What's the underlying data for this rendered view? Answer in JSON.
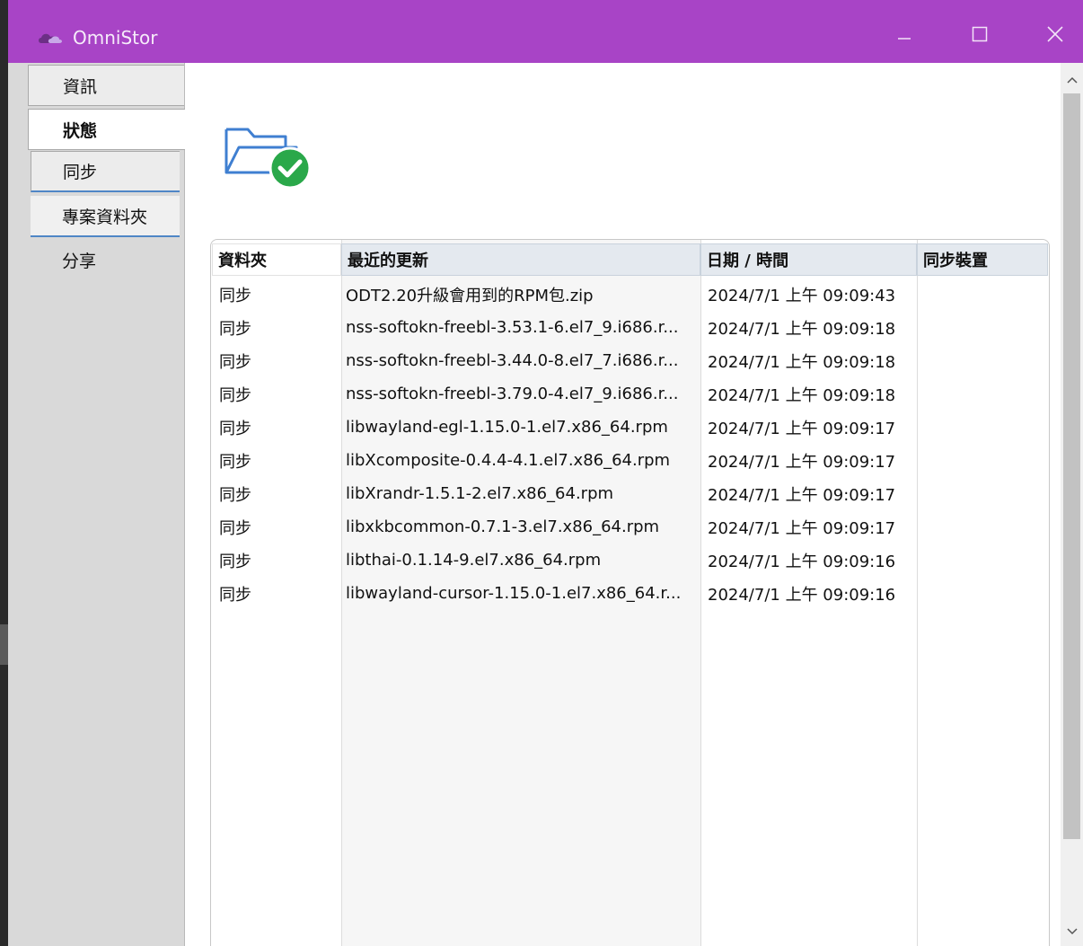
{
  "app": {
    "title": "OmniStor"
  },
  "colors": {
    "titlebar": "#a844c6",
    "accent": "#4f86c6",
    "success": "#2aa84a"
  },
  "icons": [
    "cloud-logo-icon",
    "minimize-icon",
    "maximize-icon",
    "close-icon",
    "folder-check-icon",
    "scroll-up-icon",
    "scroll-down-icon"
  ],
  "sidebar": {
    "items": [
      {
        "label": "資訊"
      },
      {
        "label": "狀態"
      },
      {
        "label": "同步"
      },
      {
        "label": "專案資料夾"
      },
      {
        "label": "分享"
      }
    ]
  },
  "table": {
    "headers": [
      "資料夾",
      "最近的更新",
      "日期 / 時間",
      "同步裝置"
    ],
    "rows": [
      [
        "同步",
        "ODT2.20升級會用到的RPM包.zip",
        "2024/7/1 上午 09:09:43",
        ""
      ],
      [
        "同步",
        "nss-softokn-freebl-3.53.1-6.el7_9.i686.r...",
        "2024/7/1 上午 09:09:18",
        ""
      ],
      [
        "同步",
        "nss-softokn-freebl-3.44.0-8.el7_7.i686.r...",
        "2024/7/1 上午 09:09:18",
        ""
      ],
      [
        "同步",
        "nss-softokn-freebl-3.79.0-4.el7_9.i686.r...",
        "2024/7/1 上午 09:09:18",
        ""
      ],
      [
        "同步",
        "libwayland-egl-1.15.0-1.el7.x86_64.rpm",
        "2024/7/1 上午 09:09:17",
        ""
      ],
      [
        "同步",
        "libXcomposite-0.4.4-4.1.el7.x86_64.rpm",
        "2024/7/1 上午 09:09:17",
        ""
      ],
      [
        "同步",
        "libXrandr-1.5.1-2.el7.x86_64.rpm",
        "2024/7/1 上午 09:09:17",
        ""
      ],
      [
        "同步",
        "libxkbcommon-0.7.1-3.el7.x86_64.rpm",
        "2024/7/1 上午 09:09:17",
        ""
      ],
      [
        "同步",
        "libthai-0.1.14-9.el7.x86_64.rpm",
        "2024/7/1 上午 09:09:16",
        ""
      ],
      [
        "同步",
        "libwayland-cursor-1.15.0-1.el7.x86_64.r...",
        "2024/7/1 上午 09:09:16",
        ""
      ]
    ]
  }
}
